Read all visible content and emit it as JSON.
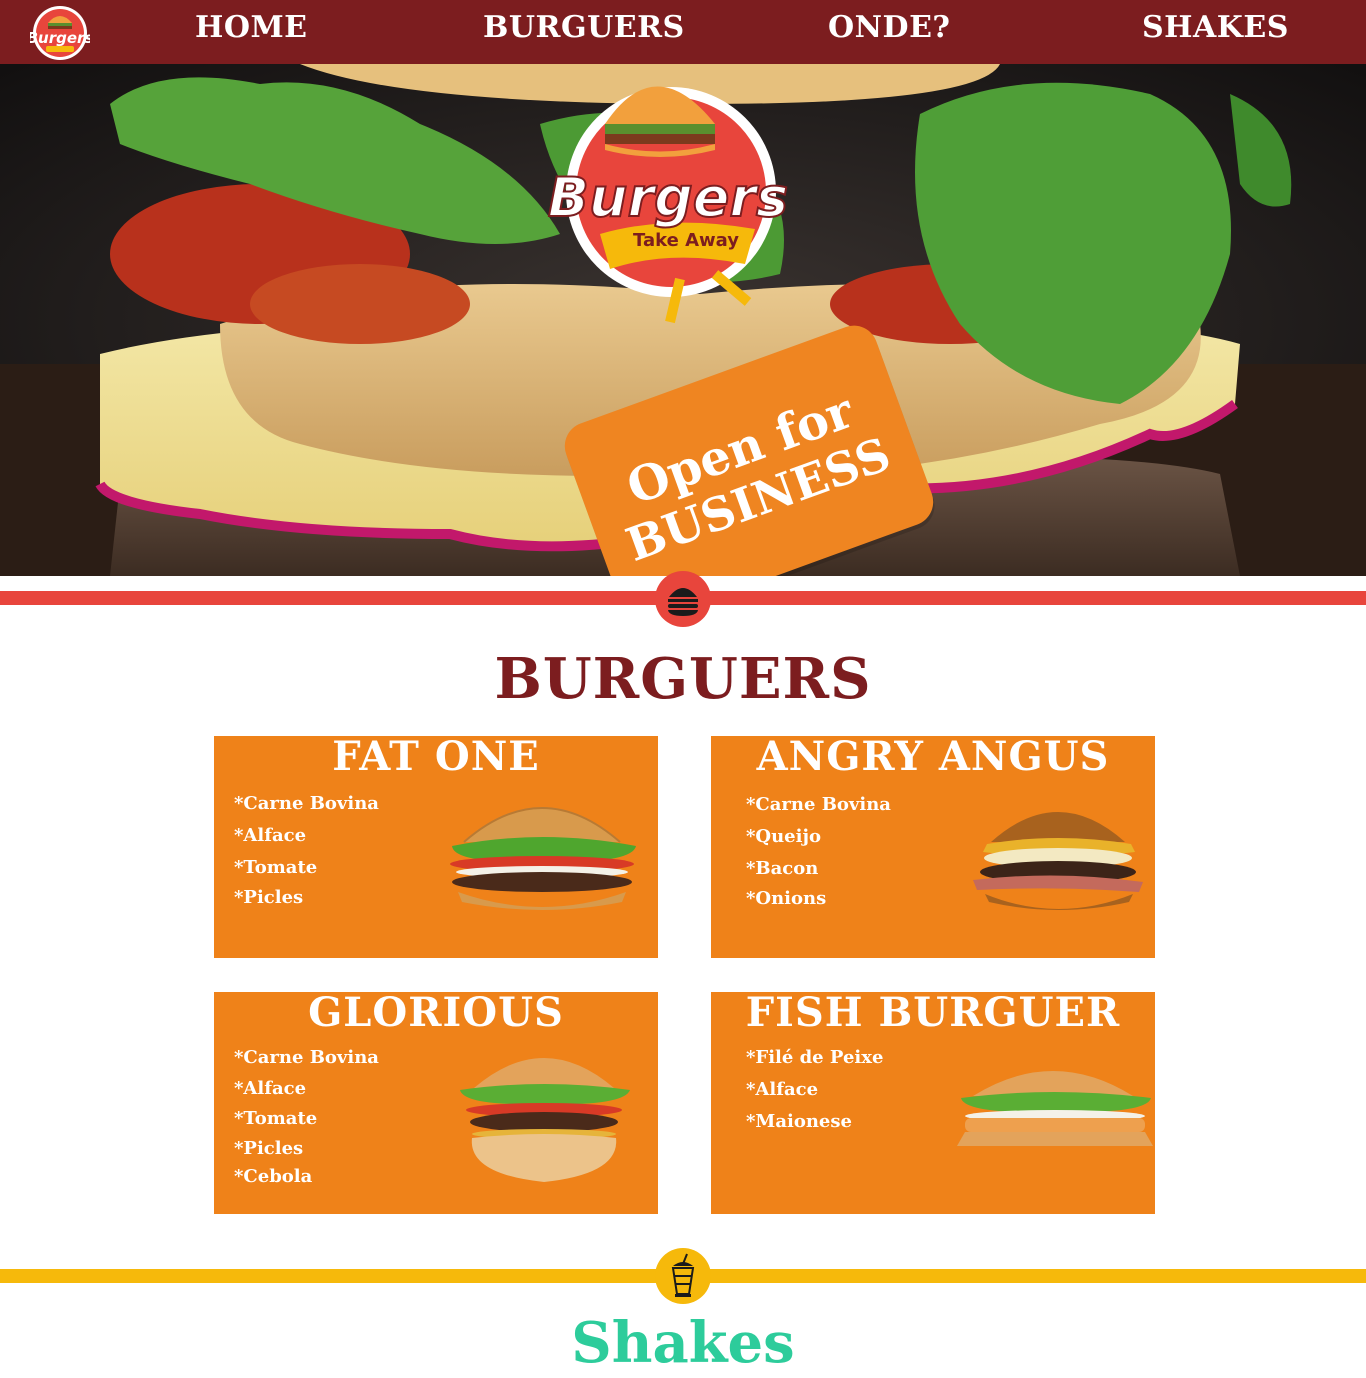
{
  "nav": {
    "logo_text": "Burgers",
    "links": [
      "HOME",
      "BURGUERS",
      "ONDE?",
      "SHAKES"
    ]
  },
  "hero": {
    "logo_word": "Burgers",
    "logo_tagline": "Take Away",
    "sign_line1": "Open for",
    "sign_line2": "BUSINESS"
  },
  "sections": {
    "burgers_title": "BURGUERS",
    "shakes_title": "Shakes"
  },
  "burgers": [
    {
      "name": "FAT ONE",
      "ingredients": [
        "*Carne Bovina",
        "*Alface",
        "*Tomate",
        "*Picles"
      ]
    },
    {
      "name": "ANGRY ANGUS",
      "ingredients": [
        "*Carne Bovina",
        "*Queijo",
        "*Bacon",
        "*Onions"
      ]
    },
    {
      "name": "GLORIOUS",
      "ingredients": [
        "*Carne Bovina",
        "*Alface",
        "*Tomate",
        "*Picles",
        "*Cebola"
      ]
    },
    {
      "name": "FISH BURGUER",
      "ingredients": [
        "*Filé de Peixe",
        "*Alface",
        "*Maionese"
      ]
    }
  ],
  "colors": {
    "nav_bg": "#7c1d1f",
    "card_bg": "#ef8219",
    "red_divider": "#e8453c",
    "yellow_divider": "#f6b90b",
    "shakes_title": "#2dcc9b"
  },
  "icons": {
    "burger_divider": "burger-icon",
    "shake_divider": "milkshake-icon"
  }
}
